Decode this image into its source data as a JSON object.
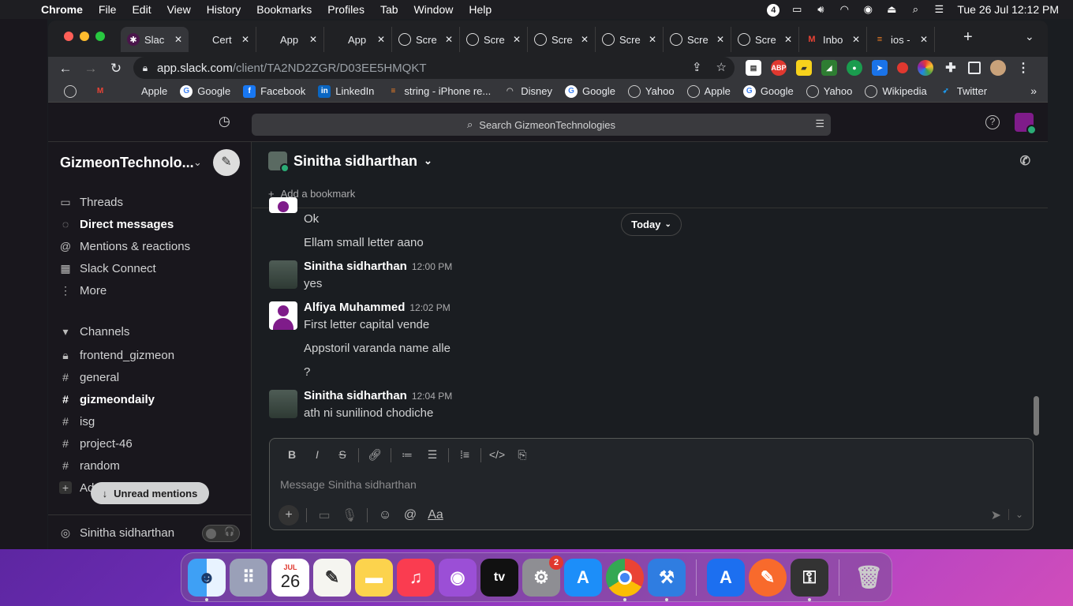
{
  "menubar": {
    "app": "Chrome",
    "items": [
      "File",
      "Edit",
      "View",
      "History",
      "Bookmarks",
      "Profiles",
      "Tab",
      "Window",
      "Help"
    ],
    "badge_count": "4",
    "clock": "Tue 26 Jul  12:12 PM"
  },
  "tabs": [
    {
      "title": "Slac",
      "active": true
    },
    {
      "title": "Cert"
    },
    {
      "title": "App"
    },
    {
      "title": "App"
    },
    {
      "title": "Scre"
    },
    {
      "title": "Scre"
    },
    {
      "title": "Scre"
    },
    {
      "title": "Scre"
    },
    {
      "title": "Scre"
    },
    {
      "title": "Scre"
    },
    {
      "title": "Inbo"
    },
    {
      "title": "ios -"
    }
  ],
  "omnibox": {
    "host": "app.slack.com",
    "path": "/client/TA2ND2ZGR/D03EE5HMQKT"
  },
  "bookmarks": [
    "",
    "",
    "Apple",
    "Google",
    "Facebook",
    "LinkedIn",
    "string - iPhone re...",
    "Disney",
    "Google",
    "Yahoo",
    "Apple",
    "Google",
    "Yahoo",
    "Wikipedia",
    "Twitter"
  ],
  "slack": {
    "search_placeholder": "Search GizmeonTechnologies",
    "workspace": "GizmeonTechnolo...",
    "nav": [
      "Threads",
      "Direct messages",
      "Mentions & reactions",
      "Slack Connect",
      "More"
    ],
    "channels_header": "Channels",
    "channels": [
      "frontend_gizmeon",
      "general",
      "gizmeondaily",
      "isg",
      "project-46",
      "random"
    ],
    "add_label": "Ad",
    "unread_pill": "Unread mentions",
    "huddle_user": "Sinitha sidharthan",
    "channel_title": "Sinitha sidharthan",
    "add_bookmark": "Add a bookmark",
    "today": "Today",
    "messages": [
      {
        "text": "Ok"
      },
      {
        "text": "Ellam small letter aano"
      },
      {
        "name": "Sinitha sidharthan",
        "time": "12:00 PM",
        "text": "yes"
      },
      {
        "name": "Alfiya Muhammed",
        "time": "12:02 PM",
        "text": "First letter capital vende"
      },
      {
        "text": "Appstoril varanda name alle"
      },
      {
        "text": "?"
      },
      {
        "name": "Sinitha sidharthan",
        "time": "12:04 PM",
        "text": "ath ni sunilinod chodiche"
      }
    ],
    "composer_placeholder": "Message Sinitha sidharthan",
    "format_aa": "Aa"
  },
  "dock": {
    "calendar_month": "JUL",
    "calendar_day": "26",
    "settings_badge": "2"
  }
}
